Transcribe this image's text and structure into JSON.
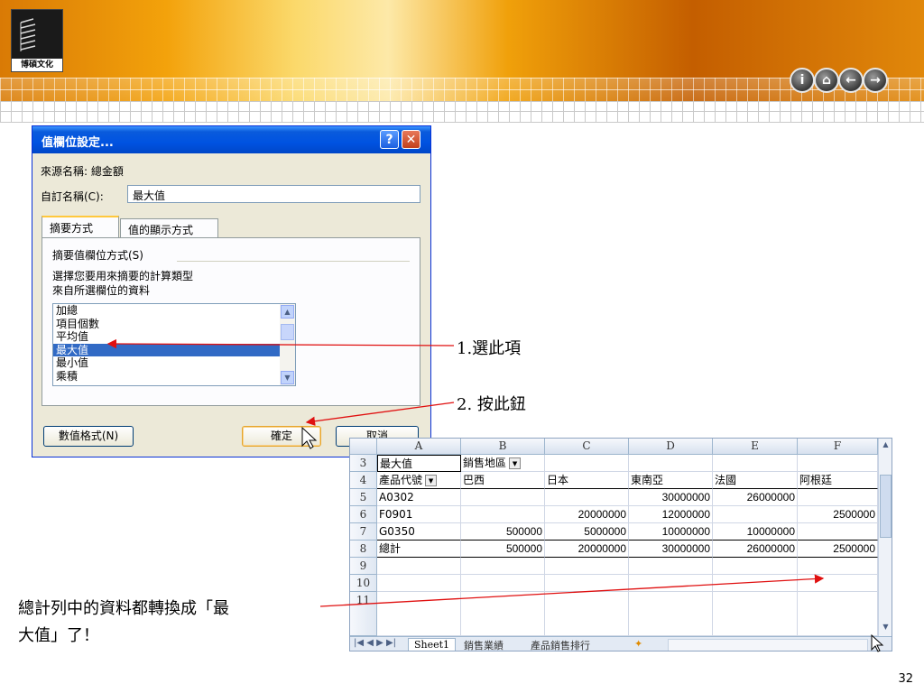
{
  "logo": {
    "text": "博碩文化"
  },
  "nav": [
    {
      "name": "info-icon",
      "glyph": "i"
    },
    {
      "name": "home-icon",
      "glyph": "⌂"
    },
    {
      "name": "back-icon",
      "glyph": "←"
    },
    {
      "name": "forward-icon",
      "glyph": "→"
    }
  ],
  "dialog": {
    "title": "值欄位設定...",
    "help_glyph": "?",
    "close_glyph": "✕",
    "source_label": "來源名稱: 總金額",
    "custom_label": "自訂名稱(C):",
    "custom_value": "最大值",
    "tabs": [
      "摘要方式",
      "值的顯示方式"
    ],
    "section_title": "摘要值欄位方式(S)",
    "instruction_line1": "選擇您要用來摘要的計算類型",
    "instruction_line2": "來自所選欄位的資料",
    "list_items": [
      "加總",
      "項目個數",
      "平均值",
      "最大值",
      "最小值",
      "乘積"
    ],
    "selected_index": 3,
    "number_format_button": "數值格式(N)",
    "ok_button": "確定",
    "cancel_button": "取消"
  },
  "excel": {
    "columns": [
      "A",
      "B",
      "C",
      "D",
      "E",
      "F"
    ],
    "rows": [
      {
        "num": "3",
        "cells": [
          "最大值",
          "銷售地區",
          "",
          "",
          "",
          ""
        ]
      },
      {
        "num": "4",
        "cells": [
          "產品代號",
          "巴西",
          "日本",
          "東南亞",
          "法國",
          "阿根廷"
        ]
      },
      {
        "num": "5",
        "cells": [
          "A0302",
          "",
          "",
          "30000000",
          "26000000",
          ""
        ]
      },
      {
        "num": "6",
        "cells": [
          "F0901",
          "",
          "20000000",
          "12000000",
          "",
          "2500000"
        ]
      },
      {
        "num": "7",
        "cells": [
          "G0350",
          "500000",
          "5000000",
          "10000000",
          "10000000",
          ""
        ]
      },
      {
        "num": "8",
        "cells": [
          "總計",
          "500000",
          "20000000",
          "30000000",
          "26000000",
          "2500000"
        ]
      },
      {
        "num": "9",
        "cells": [
          "",
          "",
          "",
          "",
          "",
          ""
        ]
      },
      {
        "num": "10",
        "cells": [
          "",
          "",
          "",
          "",
          "",
          ""
        ]
      },
      {
        "num": "11",
        "cells": [
          "",
          "",
          "",
          "",
          "",
          ""
        ]
      }
    ],
    "sheet_tabs": [
      "Sheet1",
      "銷售業績",
      "產品銷售排行"
    ]
  },
  "annotations": {
    "step1": "1.選此項",
    "step2": "2. 按此鈕",
    "note_line1": "總計列中的資料都轉換成「最",
    "note_line2": "大值」了！"
  },
  "page_number": "32"
}
